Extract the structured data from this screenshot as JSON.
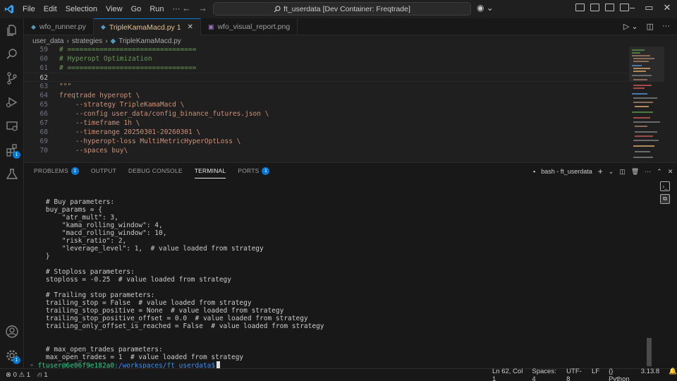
{
  "menu": [
    "File",
    "Edit",
    "Selection",
    "View",
    "Go",
    "Run"
  ],
  "search": {
    "text": "ft_userdata [Dev Container: Freqtrade]"
  },
  "tabs": [
    {
      "label": "wfo_runner.py",
      "active": false
    },
    {
      "label": "TripleKamaMacd.py 1",
      "active": true
    },
    {
      "label": "wfo_visual_report.png",
      "active": false
    }
  ],
  "breadcrumb": [
    "user_data",
    "strategies",
    "TripleKamaMacd.py"
  ],
  "editor": {
    "lines": [
      {
        "n": "59",
        "text": "# ================================",
        "cls": "c-com"
      },
      {
        "n": "60",
        "text": "# Hyperopt Optimization",
        "cls": "c-com"
      },
      {
        "n": "61",
        "text": "# ================================",
        "cls": "c-com"
      },
      {
        "n": "62",
        "text": "",
        "cls": ""
      },
      {
        "n": "63",
        "text": "\"\"\"",
        "cls": "c-str"
      },
      {
        "n": "64",
        "text": "freqtrade hyperopt \\",
        "cls": "c-str"
      },
      {
        "n": "65",
        "text": "    --strategy TripleKamaMacd \\",
        "cls": "c-str"
      },
      {
        "n": "66",
        "text": "    --config user_data/config_binance_futures.json \\",
        "cls": "c-str"
      },
      {
        "n": "67",
        "text": "    --timeframe 1h \\",
        "cls": "c-str"
      },
      {
        "n": "68",
        "text": "    --timerange 20250301-20260301 \\",
        "cls": "c-str"
      },
      {
        "n": "69",
        "text": "    --hyperopt-loss MultiMetricHyperOptLoss \\",
        "cls": "c-str"
      },
      {
        "n": "70",
        "text": "    --spaces buy\\",
        "cls": "c-str"
      }
    ]
  },
  "panel": {
    "tabs": [
      {
        "label": "PROBLEMS",
        "badge": "1"
      },
      {
        "label": "OUTPUT",
        "badge": ""
      },
      {
        "label": "DEBUG CONSOLE",
        "badge": ""
      },
      {
        "label": "TERMINAL",
        "badge": "",
        "active": true
      },
      {
        "label": "PORTS",
        "badge": "1"
      }
    ],
    "shell": "bash - ft_userdata"
  },
  "terminal": {
    "lines": [
      "    # Buy parameters:",
      "    buy_params = {",
      "        \"atr_mult\": 3,",
      "        \"kama_rolling_window\": 4,",
      "        \"macd_rolling_window\": 10,",
      "        \"risk_ratio\": 2,",
      "        \"leverage_level\": 1,  # value loaded from strategy",
      "    }",
      "",
      "    # Stoploss parameters:",
      "    stoploss = -0.25  # value loaded from strategy",
      "",
      "    # Trailing stop parameters:",
      "    trailing_stop = False  # value loaded from strategy",
      "    trailing_stop_positive = None  # value loaded from strategy",
      "    trailing_stop_positive_offset = 0.0  # value loaded from strategy",
      "    trailing_only_offset_is_reached = False  # value loaded from strategy",
      "",
      "",
      "    # max_open_trades parameters:",
      "    max_open_trades = 1  # value loaded from strategy"
    ],
    "prompt_user": "ftuser@6e06f9e182a0",
    "prompt_path": ":/workspaces/ft_userdata$"
  },
  "status": {
    "errors": "0",
    "warnings": "1",
    "info": "1",
    "position": "Ln 62, Col 1",
    "spaces": "Spaces: 4",
    "encoding": "UTF-8",
    "eol": "LF",
    "language": "Python",
    "version": "3.13.8"
  },
  "activity_badges": {
    "source_control": "",
    "extensions": "1",
    "settings": "1"
  }
}
